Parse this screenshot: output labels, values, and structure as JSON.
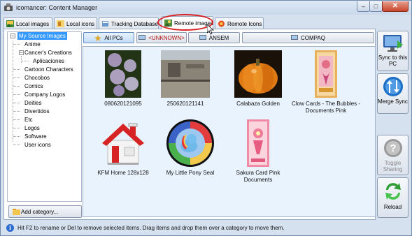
{
  "window": {
    "title": "icomancer: Content Manager"
  },
  "tabs": [
    {
      "label": "Local images",
      "icon": "local-images-icon"
    },
    {
      "label": "Local icons",
      "icon": "local-icons-icon"
    },
    {
      "label": "Tracking Database",
      "icon": "database-icon"
    },
    {
      "label": "Remote images",
      "icon": "remote-images-icon",
      "selected": true
    },
    {
      "label": "Remote Icons",
      "icon": "remote-icons-icon"
    }
  ],
  "tree": {
    "root": "My Source Images",
    "items": [
      "Anime",
      "Cancer's Creations",
      "Aplicaciones",
      "Cartoon Characters",
      "Chocobos",
      "Comics",
      "Company Logos",
      "Deities",
      "Divertidos",
      "Etc",
      "Logos",
      "Software",
      "User icons"
    ]
  },
  "add_category": {
    "label": "Add category..."
  },
  "filters": [
    {
      "label": "All PCs",
      "active": true
    },
    {
      "label": "<UNKNOWN>"
    },
    {
      "label": "ANSEM"
    },
    {
      "label": "COMPAQ"
    }
  ],
  "items": [
    {
      "caption": "080620121095"
    },
    {
      "caption": "250620121141"
    },
    {
      "caption": "Calabaza Golden"
    },
    {
      "caption": "Clow Cards - The Bubbles - Documents Pink"
    },
    {
      "caption": "KFM Home 128x128"
    },
    {
      "caption": "My Little Pony Seal"
    },
    {
      "caption": "Sakura Card Pink Documents"
    }
  ],
  "side_buttons": {
    "sync": "Sync to this PC",
    "merge": "Merge Sync",
    "toggle": "Toggle Sharing",
    "reload": "Reload"
  },
  "status": {
    "text": "Hit F2 to rename or Del to remove selected items. Drag items and drop them over a category to move them."
  },
  "colors": {
    "highlight_oval": "#d81f1f",
    "selection": "#3399ff",
    "gallery_bg": "#e9f3fd"
  }
}
